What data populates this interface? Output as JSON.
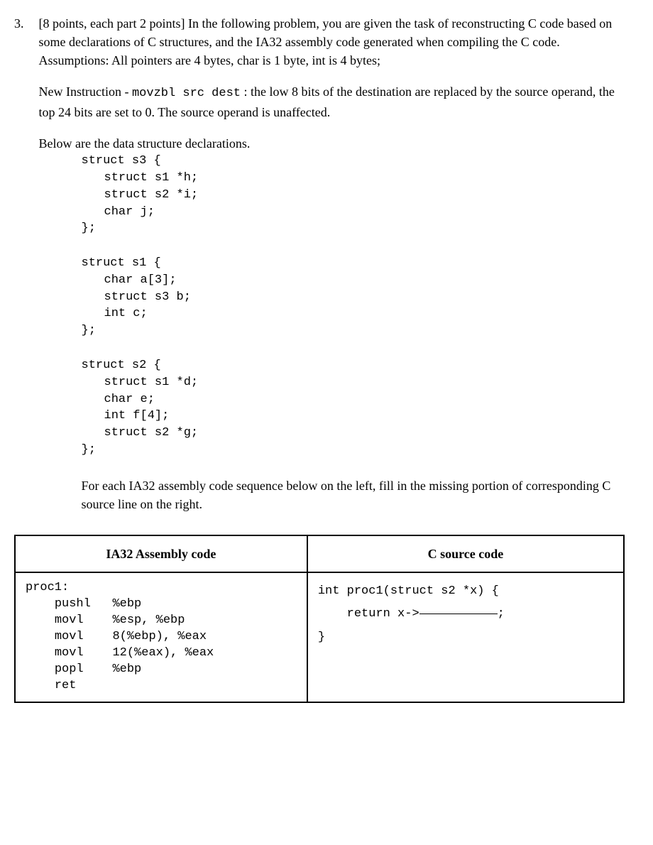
{
  "question": {
    "number": "3.",
    "prompt_part1": "[8 points, each part 2 points] In the following problem, you are given the task of reconstructing C code based on some declarations of C structures, and the IA32 assembly code generated when compiling the C code.",
    "assumptions": "Assumptions: All pointers are 4 bytes, char is 1 byte, int is 4 bytes;",
    "new_instruction_label": "New Instruction - ",
    "new_instruction_code": "movzbl src dest",
    "new_instruction_desc": " : the low 8 bits of the destination are replaced by the source operand, the top 24 bits are set to 0. The source operand is unaffected.",
    "below_decl": "Below are the data structure declarations."
  },
  "structs": {
    "s3": {
      "open": "struct s3 {",
      "m1": "struct s1 *h;",
      "m2": "struct s2 *i;",
      "m3": "char j;",
      "close": "};"
    },
    "s1": {
      "open": "struct s1 {",
      "m1": "char a[3];",
      "m2": "struct s3 b;",
      "m3": "int c;",
      "close": "};"
    },
    "s2": {
      "open": "struct s2 {",
      "m1": "struct s1 *d;",
      "m2": "char e;",
      "m3": "int f[4];",
      "m4": "struct s2 *g;",
      "close": "};"
    }
  },
  "fill_instruction": "For each IA32 assembly code sequence below on the left, fill in the missing portion of corresponding C source line on the right.",
  "table": {
    "header_asm": "IA32 Assembly code",
    "header_c": "C source code",
    "asm": {
      "label": "proc1:",
      "l1a": "pushl",
      "l1b": "%ebp",
      "l2a": "movl",
      "l2b": "%esp, %ebp",
      "l3a": "movl",
      "l3b": "8(%ebp), %eax",
      "l4a": "movl",
      "l4b": "12(%eax), %eax",
      "l5a": "popl",
      "l5b": "%ebp",
      "l6a": "ret",
      "l6b": ""
    },
    "c": {
      "sig": "int proc1(struct s2 *x) {",
      "ret_prefix": "return x->",
      "ret_suffix": ";",
      "close": "}"
    }
  }
}
